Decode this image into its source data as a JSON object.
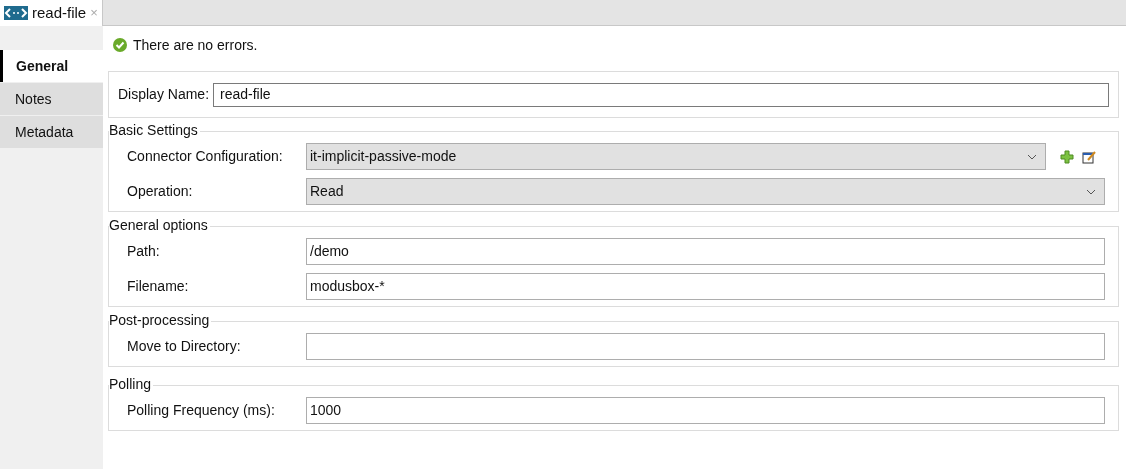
{
  "editor_tab": {
    "title": "read-file",
    "close": "×"
  },
  "status": {
    "message": "There are no errors."
  },
  "side_tabs": [
    {
      "label": "General",
      "selected": true
    },
    {
      "label": "Notes",
      "selected": false
    },
    {
      "label": "Metadata",
      "selected": false
    }
  ],
  "display_name": {
    "label": "Display Name:",
    "value": "read-file"
  },
  "sections": [
    {
      "title": "Basic Settings",
      "fields": [
        {
          "label": "Connector Configuration:",
          "kind": "dropdown",
          "value": "it-implicit-passive-mode",
          "actions": true
        },
        {
          "label": "Operation:",
          "kind": "dropdown",
          "value": "Read",
          "actions": false
        }
      ]
    },
    {
      "title": "General options",
      "fields": [
        {
          "label": "Path:",
          "kind": "text",
          "value": "/demo"
        },
        {
          "label": "Filename:",
          "kind": "text",
          "value": "modusbox-*"
        }
      ]
    },
    {
      "title": "Post-processing",
      "fields": [
        {
          "label": "Move to Directory:",
          "kind": "text"
        }
      ]
    },
    {
      "title": "Polling",
      "fields": [
        {
          "label": "Polling Frequency (ms):",
          "kind": "text",
          "value": "1000"
        }
      ]
    }
  ]
}
